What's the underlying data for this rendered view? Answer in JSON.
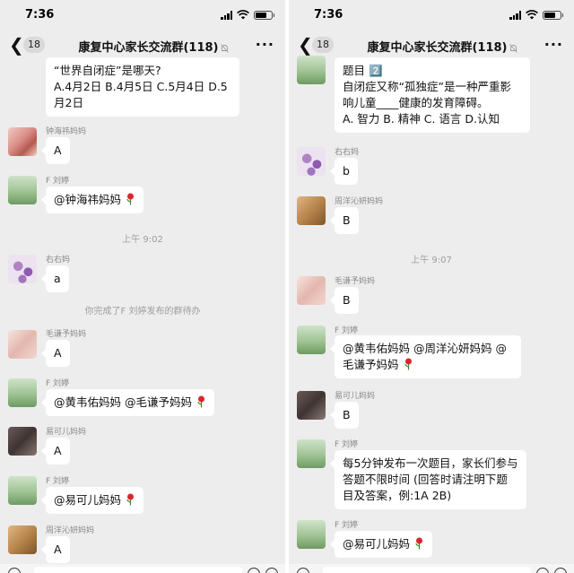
{
  "status": {
    "time": "7:36"
  },
  "nav": {
    "badge": "18",
    "title": "康复中心家长交流群(118)",
    "back_icon": "chevron-left-icon",
    "mute_icon": "bell-off-icon",
    "more_icon": "more-icon"
  },
  "left": {
    "m0": {
      "text": "“世界自闭症”是哪天?\nA.4月2日 B.4月5日 C.5月4日 D.5月2日"
    },
    "m1": {
      "sender": "钟海祎妈妈",
      "text": "A"
    },
    "m2": {
      "sender": "F 刘婷",
      "text": "@钟海祎妈妈"
    },
    "t1": "上午 9:02",
    "m3": {
      "sender": "右右妈",
      "text": "a"
    },
    "sys1": "你完成了F 刘婷发布的群待办",
    "m4": {
      "sender": "毛谦予妈妈",
      "text": "A"
    },
    "m5": {
      "sender": "F 刘婷",
      "text": "@黄韦佑妈妈 @毛谦予妈妈"
    },
    "m6": {
      "sender": "易可儿妈妈",
      "text": "A"
    },
    "m7": {
      "sender": "F 刘婷",
      "text": "@易可儿妈妈"
    },
    "m8": {
      "sender": "周洋沁妍妈妈",
      "text": "A"
    }
  },
  "right": {
    "m0": {
      "text": "题目 2️⃣\n自闭症又称“孤独症”是一种严重影响儿童____健康的发育障碍。\nA. 智力 B. 精神 C. 语言 D.认知"
    },
    "m1": {
      "sender": "右右妈",
      "text": "b"
    },
    "m2": {
      "sender": "周洋沁妍妈妈",
      "text": "B"
    },
    "t1": "上午 9:07",
    "m3": {
      "sender": "毛谦予妈妈",
      "text": "B"
    },
    "m4": {
      "sender": "F 刘婷",
      "text": "@黄韦佑妈妈 @周洋沁妍妈妈 @毛谦予妈妈"
    },
    "m5": {
      "sender": "易可儿妈妈",
      "text": "B"
    },
    "m6": {
      "sender": "F 刘婷",
      "text": "每5分钟发布一次题目，家长们参与答题不限时间 (回答时请注明下题目及答案，例:1A 2B)"
    },
    "m7": {
      "sender": "F 刘婷",
      "text": "@易可儿妈妈"
    }
  },
  "colors": {
    "chat_bg": "#ededed",
    "bubble": "#ffffff",
    "accent_rose": "#d8262e"
  }
}
